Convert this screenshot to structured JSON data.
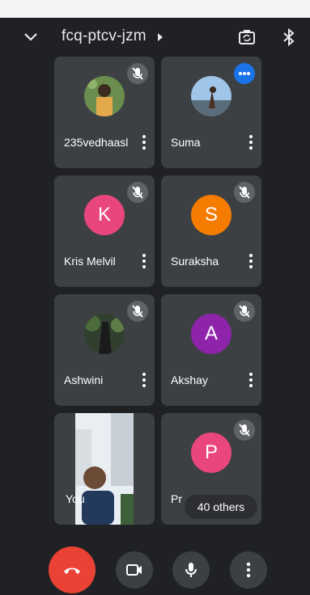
{
  "meeting": {
    "code": "fcq-ptcv-jzm"
  },
  "participants": [
    {
      "name": "235vedhaasl",
      "avatar_type": "photo"
    },
    {
      "name": "Suma",
      "avatar_type": "photo"
    },
    {
      "name": "Kris Melvil",
      "initial": "K",
      "avatar_color": "#e8467c"
    },
    {
      "name": "Suraksha",
      "initial": "S",
      "avatar_color": "#f57c00"
    },
    {
      "name": "Ashwini",
      "avatar_type": "photo"
    },
    {
      "name": "Akshay",
      "initial": "A",
      "avatar_color": "#8e24aa"
    },
    {
      "name": "You",
      "avatar_type": "video"
    },
    {
      "name": "Pr",
      "initial": "P",
      "avatar_color": "#e8467c"
    }
  ],
  "others_label": "40 others",
  "controls": {
    "end_call": "end-call",
    "camera": "camera",
    "mic": "mic",
    "more": "more"
  }
}
